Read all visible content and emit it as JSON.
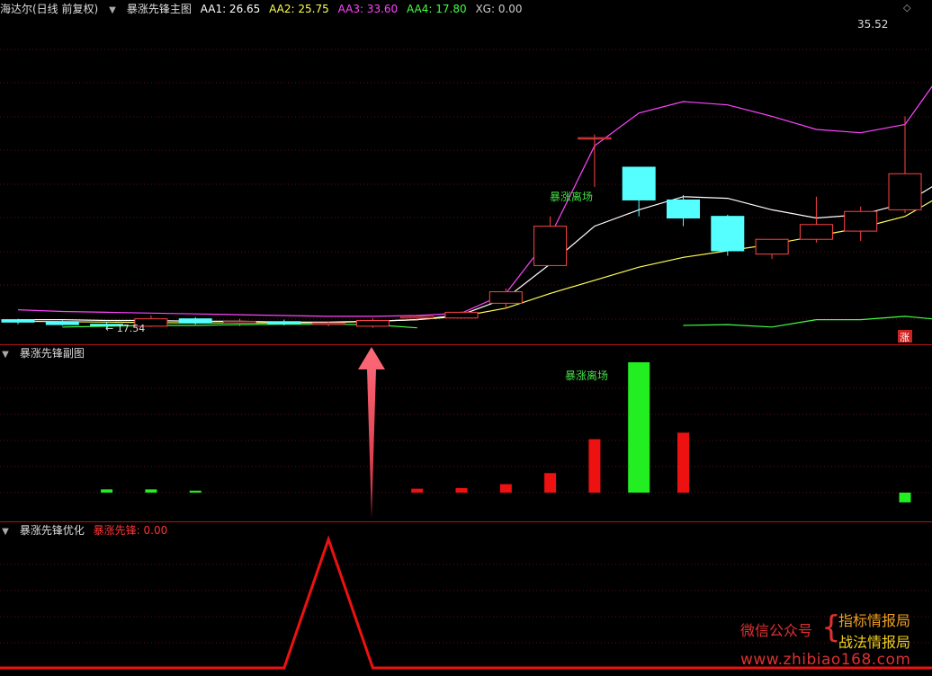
{
  "main_panel": {
    "stock_name": "海达尔(日线 前复权)",
    "indicator_name": "暴涨先锋主图",
    "aa1": "AA1: 26.65",
    "aa2": "AA2: 25.75",
    "aa3": "AA3: 33.60",
    "aa4": "AA4: 17.80",
    "xg": "XG: 0.00",
    "high_label": "35.52",
    "low_label": "← 17.54",
    "signal_text": "暴涨离场",
    "rise_tag": "涨",
    "colors": {
      "aa1": "#ffffff",
      "aa2": "#ffff55",
      "aa3": "#ff44ff",
      "aa4": "#44ff44"
    }
  },
  "sub_panel": {
    "indicator_name": "暴涨先锋副图",
    "signal_text": "暴涨离场"
  },
  "opt_panel": {
    "indicator_name": "暴涨先锋优化",
    "value_label": "暴涨先锋: 0.00"
  },
  "watermark": {
    "label": "微信公众号",
    "name1": "指标情报局",
    "name2": "战法情报局",
    "site": "www.zhibiao168.com"
  },
  "candles": [
    {
      "o": 17.9,
      "h": 17.95,
      "l": 17.62,
      "c": 17.75
    },
    {
      "o": 17.78,
      "h": 17.85,
      "l": 17.54,
      "c": 17.6
    },
    {
      "o": 17.62,
      "h": 17.75,
      "l": 17.4,
      "c": 17.55
    },
    {
      "o": 17.5,
      "h": 18.15,
      "l": 17.45,
      "c": 17.95
    },
    {
      "o": 17.95,
      "h": 18.05,
      "l": 17.6,
      "c": 17.7
    },
    {
      "o": 17.7,
      "h": 17.95,
      "l": 17.5,
      "c": 17.8
    },
    {
      "o": 17.78,
      "h": 17.9,
      "l": 17.55,
      "c": 17.65
    },
    {
      "o": 17.62,
      "h": 17.8,
      "l": 17.5,
      "c": 17.7
    },
    {
      "o": 17.5,
      "h": 18.0,
      "l": 17.4,
      "c": 17.85
    },
    {
      "o": 18.0,
      "h": 18.2,
      "l": 17.9,
      "c": 18.1
    },
    {
      "o": 18.0,
      "h": 18.4,
      "l": 17.95,
      "c": 18.35
    },
    {
      "o": 18.9,
      "h": 19.8,
      "l": 18.6,
      "c": 19.6
    },
    {
      "o": 21.2,
      "h": 24.2,
      "l": 21.8,
      "c": 23.6
    },
    {
      "o": 29.0,
      "h": 29.2,
      "l": 26.0,
      "c": 29.0
    },
    {
      "o": 27.2,
      "h": 26.5,
      "l": 24.2,
      "c": 25.2
    },
    {
      "o": 25.2,
      "h": 25.5,
      "l": 23.6,
      "c": 24.1
    },
    {
      "o": 24.2,
      "h": 24.3,
      "l": 21.8,
      "c": 22.1
    },
    {
      "o": 21.9,
      "h": 22.7,
      "l": 21.6,
      "c": 22.8
    },
    {
      "o": 22.8,
      "h": 25.4,
      "l": 22.6,
      "c": 23.7
    },
    {
      "o": 23.3,
      "h": 24.8,
      "l": 22.7,
      "c": 24.5
    },
    {
      "o": 24.6,
      "h": 30.3,
      "l": 24.4,
      "c": 26.8
    },
    {
      "o": 28.4,
      "h": 35.52,
      "l": 28.4,
      "c": 35.3
    }
  ],
  "lines": {
    "aa3": [
      18.5,
      18.4,
      18.35,
      18.3,
      18.25,
      18.2,
      18.15,
      18.1,
      18.1,
      18.15,
      18.3,
      19.5,
      23.0,
      28.5,
      30.5,
      31.2,
      31.0,
      30.3,
      29.5,
      29.3,
      29.8,
      33.6
    ],
    "aa1": [
      17.9,
      17.9,
      17.85,
      17.85,
      17.8,
      17.8,
      17.75,
      17.75,
      17.8,
      17.9,
      18.2,
      19.2,
      21.3,
      23.6,
      24.6,
      25.4,
      25.3,
      24.6,
      24.1,
      24.3,
      25.0,
      26.65
    ],
    "aa2": [
      17.8,
      17.78,
      17.75,
      17.72,
      17.7,
      17.7,
      17.7,
      17.72,
      17.8,
      17.9,
      18.1,
      18.6,
      19.5,
      20.3,
      21.1,
      21.7,
      22.1,
      22.5,
      23.0,
      23.5,
      24.2,
      25.75
    ],
    "aa4_seg1": [
      17.45,
      17.5,
      17.55,
      17.55,
      17.6,
      17.62,
      17.62,
      17.6,
      17.4
    ],
    "aa4_seg2": [
      17.55,
      17.6,
      17.45,
      17.9,
      17.9,
      18.1,
      17.85
    ]
  },
  "sub_bars": [
    {
      "v": 0.05,
      "c": "green"
    },
    {
      "v": 0.05,
      "c": "green"
    },
    {
      "v": 0.03,
      "c": "green"
    },
    {
      "v": 0,
      "c": "none"
    },
    {
      "v": 0,
      "c": "none"
    },
    {
      "v": 0,
      "c": "none"
    },
    {
      "v": 0,
      "c": "none"
    },
    {
      "v": 0.06,
      "c": "red"
    },
    {
      "v": 0.07,
      "c": "red"
    },
    {
      "v": 0.13,
      "c": "red"
    },
    {
      "v": 0.3,
      "c": "red"
    },
    {
      "v": 0.82,
      "c": "red"
    },
    {
      "v": 2.0,
      "c": "green"
    },
    {
      "v": 0.92,
      "c": "red"
    },
    {
      "v": 0,
      "c": "none"
    },
    {
      "v": 0,
      "c": "none"
    },
    {
      "v": 0,
      "c": "none"
    },
    {
      "v": 0,
      "c": "none"
    },
    {
      "v": -0.15,
      "c": "green"
    },
    {
      "v": 0.23,
      "c": "red"
    },
    {
      "v": 1.26,
      "c": "red"
    }
  ],
  "opt_line": [
    0,
    0,
    0,
    0,
    0,
    0,
    0,
    1,
    0,
    0,
    0,
    0,
    0,
    0,
    0,
    0,
    0,
    0,
    0,
    0,
    0,
    0
  ]
}
